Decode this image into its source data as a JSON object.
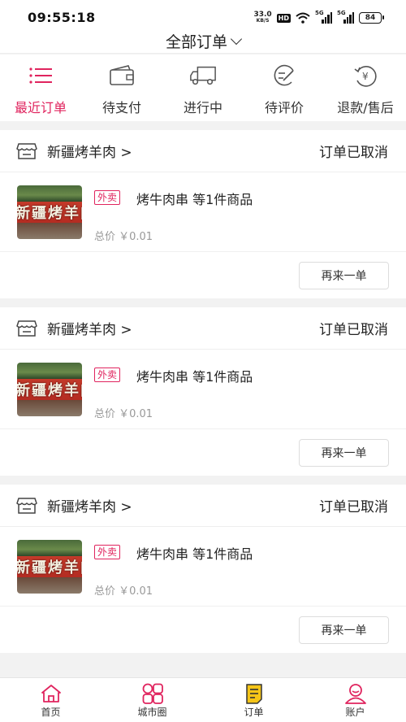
{
  "status_bar": {
    "time": "09:55:18",
    "net_speed": "33.0",
    "net_unit": "KB/S",
    "hd": "HD",
    "sig1": "5G",
    "sig2": "5G",
    "battery": "84"
  },
  "header": {
    "title": "全部订单"
  },
  "tabs": [
    {
      "label": "最近订单",
      "icon": "list-icon",
      "active": true
    },
    {
      "label": "待支付",
      "icon": "wallet-icon",
      "active": false
    },
    {
      "label": "进行中",
      "icon": "truck-icon",
      "active": false
    },
    {
      "label": "待评价",
      "icon": "review-icon",
      "active": false
    },
    {
      "label": "退款/售后",
      "icon": "refund-icon",
      "active": false
    }
  ],
  "orders": [
    {
      "shop": "新疆烤羊肉 >",
      "status": "订单已取消",
      "tag": "外卖",
      "title": "烤牛肉串 等1件商品",
      "price": "总价 ￥0.01",
      "thumb_text": "新疆烤羊肉",
      "button": "再来一单"
    },
    {
      "shop": "新疆烤羊肉 >",
      "status": "订单已取消",
      "tag": "外卖",
      "title": "烤牛肉串 等1件商品",
      "price": "总价 ￥0.01",
      "thumb_text": "新疆烤羊肉",
      "button": "再来一单"
    },
    {
      "shop": "新疆烤羊肉 >",
      "status": "订单已取消",
      "tag": "外卖",
      "title": "烤牛肉串 等1件商品",
      "price": "总价 ￥0.01",
      "thumb_text": "新疆烤羊肉",
      "button": "再来一单"
    }
  ],
  "bottom_nav": [
    {
      "label": "首页",
      "icon": "home-icon"
    },
    {
      "label": "城市圈",
      "icon": "city-circle-icon"
    },
    {
      "label": "订单",
      "icon": "orders-icon"
    },
    {
      "label": "账户",
      "icon": "account-icon"
    }
  ],
  "colors": {
    "accent": "#e0245e",
    "order_icon": "#f5c518",
    "text": "#222222",
    "muted": "#999999"
  }
}
